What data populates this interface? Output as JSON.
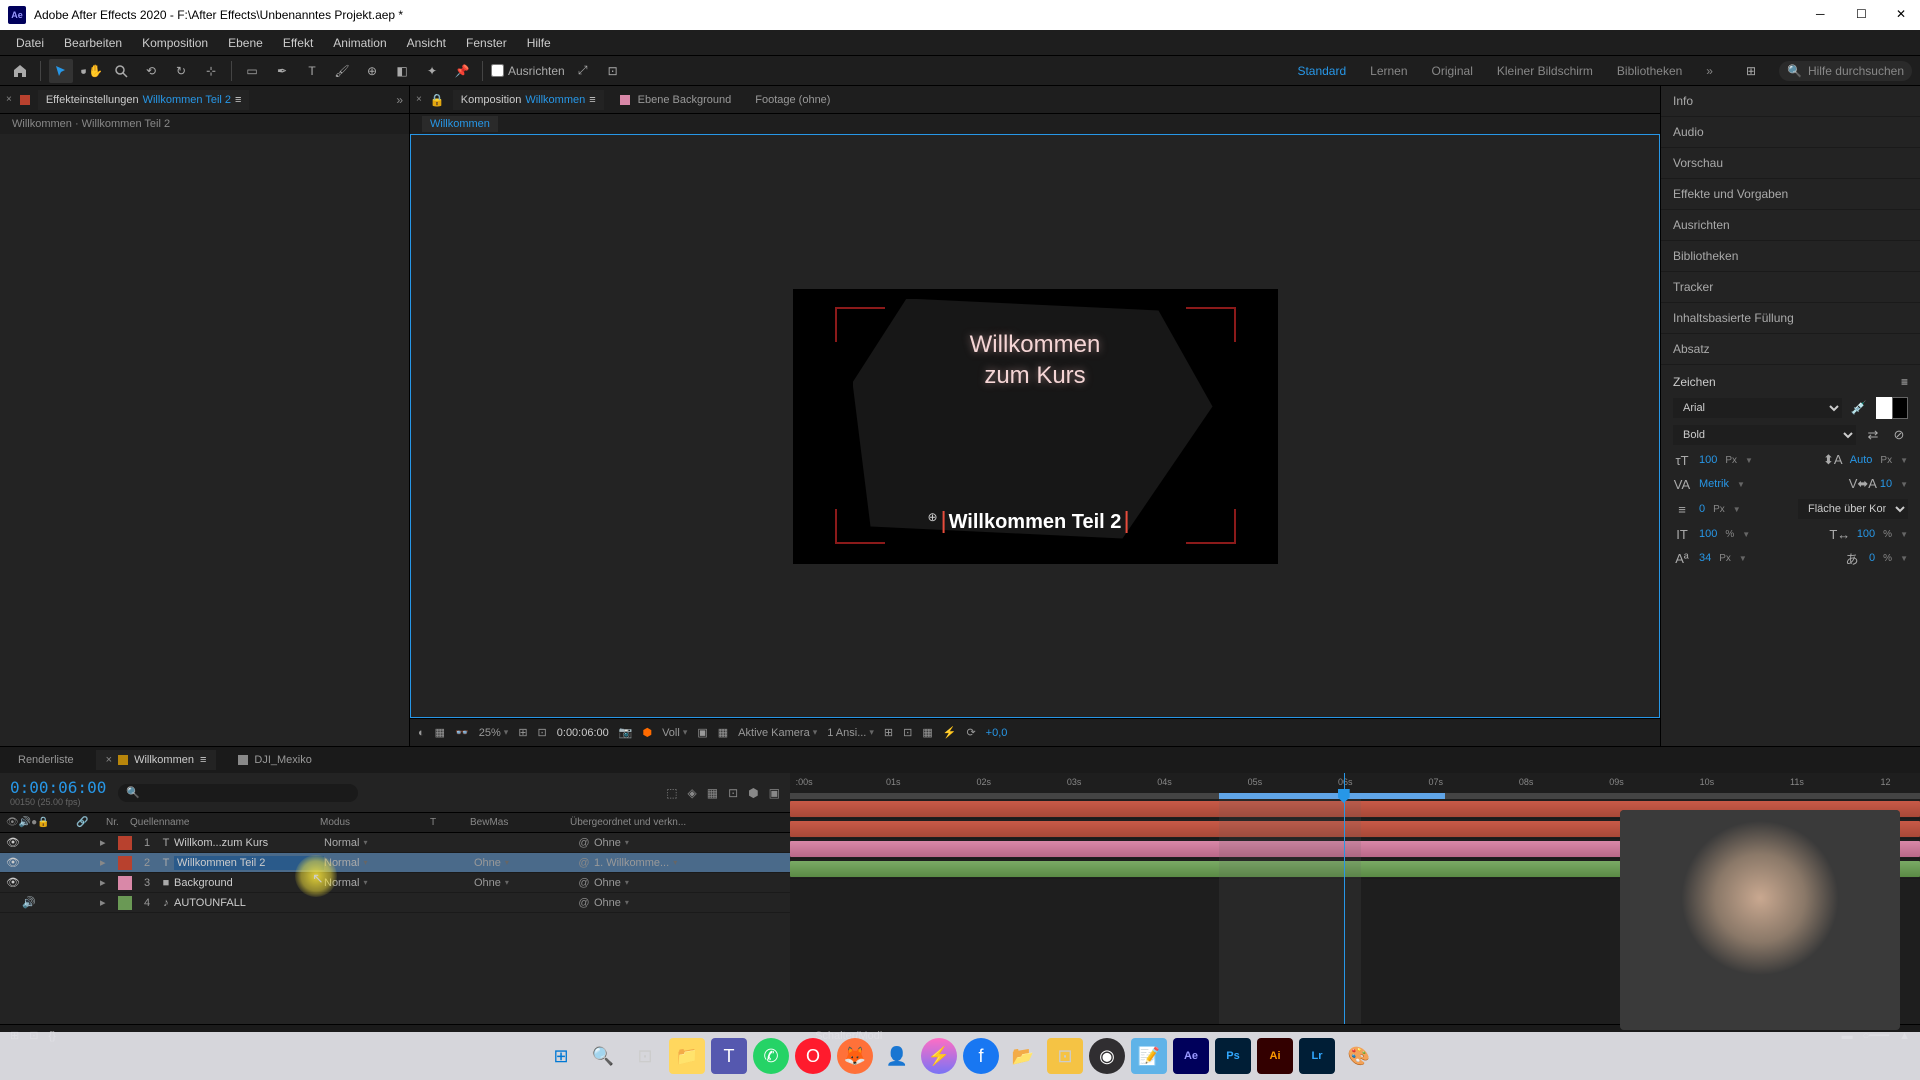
{
  "window": {
    "title": "Adobe After Effects 2020 - F:\\After Effects\\Unbenanntes Projekt.aep *"
  },
  "menu": [
    "Datei",
    "Bearbeiten",
    "Komposition",
    "Ebene",
    "Effekt",
    "Animation",
    "Ansicht",
    "Fenster",
    "Hilfe"
  ],
  "toolbar": {
    "ausrichten": "Ausrichten",
    "search_placeholder": "Hilfe durchsuchen"
  },
  "workspaces": [
    "Standard",
    "Lernen",
    "Original",
    "Kleiner Bildschirm",
    "Bibliotheken"
  ],
  "left_panel": {
    "tab_prefix": "Effekteinstellungen",
    "tab_name": "Willkommen Teil 2",
    "breadcrumb": "Willkommen · Willkommen Teil 2"
  },
  "center_panel": {
    "tab1_prefix": "Komposition",
    "tab1_name": "Willkommen",
    "tab2": "Ebene Background",
    "tab3": "Footage (ohne)",
    "subtab": "Willkommen"
  },
  "comp": {
    "text_line1": "Willkommen",
    "text_line2": "zum Kurs",
    "text_sub": "Willkommen Teil 2"
  },
  "viewer": {
    "zoom": "25%",
    "time": "0:00:06:00",
    "resolution": "Voll",
    "camera": "Aktive Kamera",
    "views": "1 Ansi...",
    "exposure": "+0,0"
  },
  "right_panels": [
    "Info",
    "Audio",
    "Vorschau",
    "Effekte und Vorgaben",
    "Ausrichten",
    "Bibliotheken",
    "Tracker",
    "Inhaltsbasierte Füllung",
    "Absatz"
  ],
  "char": {
    "title": "Zeichen",
    "font": "Arial",
    "style": "Bold",
    "size": "100",
    "size_unit": "Px",
    "leading": "Auto",
    "leading_unit": "Px",
    "kerning": "Metrik",
    "tracking": "10",
    "stroke_w": "0",
    "stroke_w_unit": "Px",
    "stroke_opt": "Fläche über Kon...",
    "vscale": "100",
    "vscale_unit": "%",
    "hscale": "100",
    "hscale_unit": "%",
    "baseline": "34",
    "baseline_unit": "Px",
    "tsume": "0",
    "tsume_unit": "%"
  },
  "timeline": {
    "tab1": "Renderliste",
    "tab2": "Willkommen",
    "tab3": "DJI_Mexiko",
    "timecode": "0:00:06:00",
    "framecount": "00150 (25.00 fps)",
    "columns": {
      "num": "Nr.",
      "name": "Quellenname",
      "mode": "Modus",
      "t": "T",
      "matte": "BewMas",
      "parent": "Übergeordnet und verkn..."
    },
    "layers": [
      {
        "num": "1",
        "type": "T",
        "name": "Willkom...zum Kurs",
        "mode": "Normal",
        "matte": "",
        "parent": "Ohne",
        "label": "red"
      },
      {
        "num": "2",
        "type": "T",
        "name": "Willkommen Teil 2",
        "mode": "Normal",
        "matte": "Ohne",
        "parent": "1. Willkomme...",
        "label": "red",
        "selected": true
      },
      {
        "num": "3",
        "type": "",
        "name": "Background",
        "mode": "Normal",
        "matte": "Ohne",
        "parent": "Ohne",
        "label": "pink"
      },
      {
        "num": "4",
        "type": "♪",
        "name": "AUTOUNFALL",
        "mode": "",
        "matte": "",
        "parent": "Ohne",
        "label": "green"
      }
    ],
    "footer": "Schalter/Modi",
    "ruler": [
      ":00s",
      "01s",
      "02s",
      "03s",
      "04s",
      "05s",
      "06s",
      "07s",
      "08s",
      "09s",
      "10s",
      "11s",
      "12"
    ]
  }
}
